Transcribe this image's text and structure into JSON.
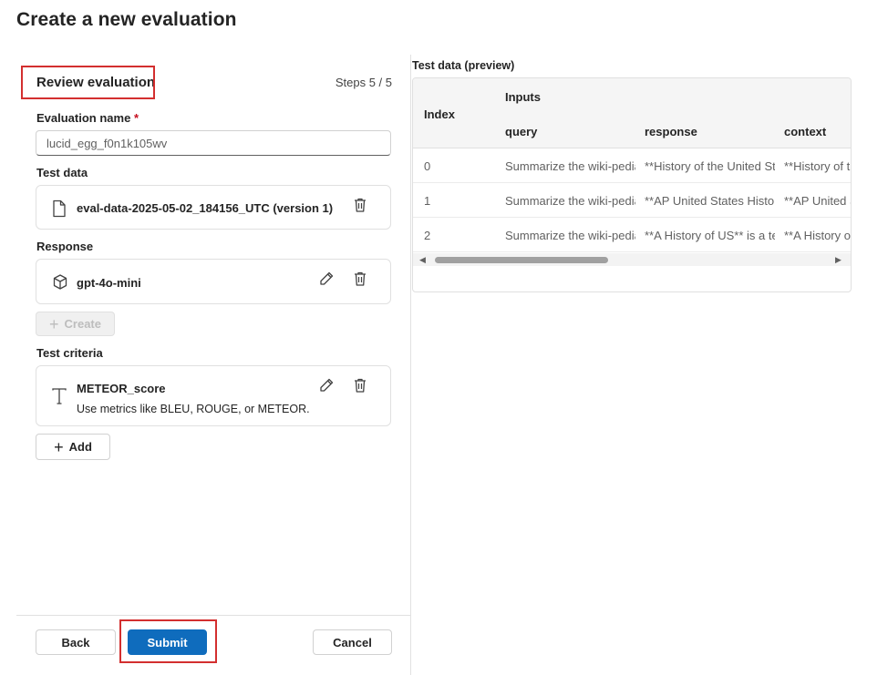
{
  "page": {
    "title": "Create a new evaluation"
  },
  "wizard": {
    "step_title": "Review evaluation",
    "steps_indicator": "Steps 5 / 5",
    "evaluation_name": {
      "label": "Evaluation name",
      "required_mark": "*",
      "value": "lucid_egg_f0n1k105wv"
    },
    "test_data": {
      "label": "Test data",
      "item_name": "eval-data-2025-05-02_184156_UTC (version 1)"
    },
    "response": {
      "label": "Response",
      "item_name": "gpt-4o-mini",
      "create_label": "Create"
    },
    "test_criteria": {
      "label": "Test criteria",
      "item_name": "METEOR_score",
      "item_description": "Use metrics like BLEU, ROUGE, or METEOR.",
      "add_label": "Add"
    },
    "footer": {
      "back_label": "Back",
      "submit_label": "Submit",
      "cancel_label": "Cancel"
    }
  },
  "preview": {
    "label": "Test data (preview)",
    "headers": {
      "index": "Index",
      "group": "Inputs",
      "columns": [
        "query",
        "response",
        "context"
      ]
    },
    "rows": [
      {
        "index": "0",
        "query": "Summarize the wiki-pedia",
        "response": "**History of the United States",
        "context": "**History of the"
      },
      {
        "index": "1",
        "query": "Summarize the wiki-pedia",
        "response": "**AP United States History",
        "context": "**AP United St"
      },
      {
        "index": "2",
        "query": "Summarize the wiki-pedia",
        "response": "**A History of US** is a te",
        "context": "**A History of"
      }
    ]
  },
  "colors": {
    "primary": "#0f6cbd",
    "highlight": "#d32f2f",
    "required": "#c50f1f"
  },
  "icons": [
    "document-icon",
    "delete-icon",
    "cube-icon",
    "edit-icon",
    "plus-icon",
    "text-icon",
    "scroll-left-icon",
    "scroll-right-icon"
  ]
}
